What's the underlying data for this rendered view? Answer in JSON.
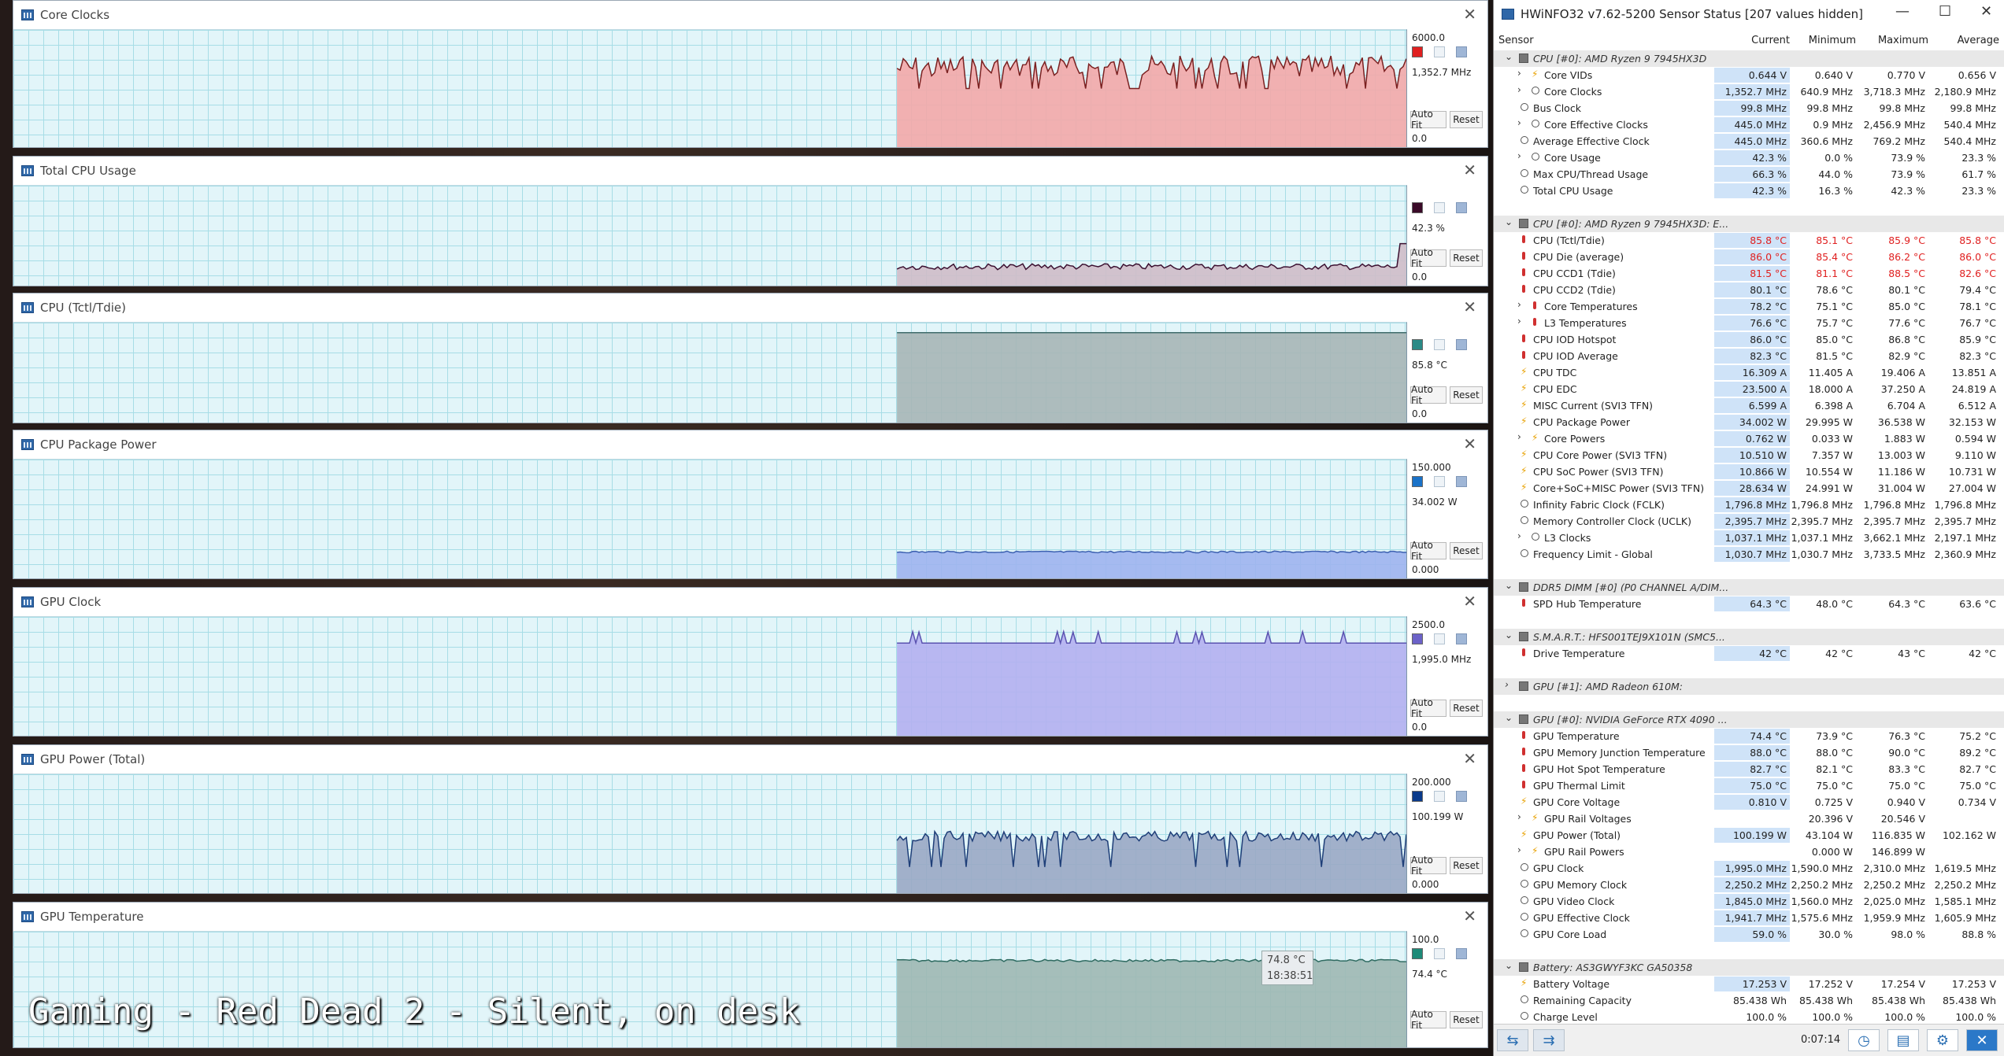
{
  "graphs": [
    {
      "title": "Core Clocks",
      "max": "6000.0",
      "current": "1,352.7 MHz",
      "min": "0.0",
      "color": "#e02020",
      "fill": "#f3a8a8",
      "stroke": "#7a2020",
      "profile": "clocks"
    },
    {
      "title": "Total CPU Usage",
      "max": "",
      "current": "42.3 %",
      "min": "0.0",
      "color": "#3a0a28",
      "fill": "#cfbcc8",
      "stroke": "#3a1030",
      "profile": "usage"
    },
    {
      "title": "CPU (Tctl/Tdie)",
      "max": "",
      "current": "85.8 °C",
      "min": "0.0",
      "color": "#2a8a86",
      "fill": "#a7b6b6",
      "stroke": "#3f6d6c",
      "profile": "flat_high"
    },
    {
      "title": "CPU Package Power",
      "max": "150.000",
      "current": "34.002 W",
      "min": "0.000",
      "color": "#1a72c8",
      "fill": "#9fb4ee",
      "stroke": "#3a5fb0",
      "profile": "flat_low"
    },
    {
      "title": "GPU Clock",
      "max": "2500.0",
      "current": "1,995.0 MHz",
      "min": "0.0",
      "color": "#6c62c8",
      "fill": "#b4b0f0",
      "stroke": "#5a52b0",
      "profile": "gpuclk"
    },
    {
      "title": "GPU Power (Total)",
      "max": "200.000",
      "current": "100.199 W",
      "min": "0.000",
      "color": "#0a3a8a",
      "fill": "#9aa8c4",
      "stroke": "#1e3e78",
      "profile": "gpupow"
    },
    {
      "title": "GPU Temperature",
      "max": "100.0",
      "current": "74.4 °C",
      "min": "",
      "color": "#1e8a78",
      "fill": "#9fb8b2",
      "stroke": "#2e6a60",
      "profile": "gputemp"
    }
  ],
  "labels": {
    "autofit": "Auto Fit",
    "reset": "Reset"
  },
  "tooltip": {
    "value": "74.8 °C",
    "time": "18:38:51"
  },
  "overlay_text": "Gaming - Red Dead 2 - Silent, on desk",
  "hwinfo": {
    "title": "HWiNFO32 v7.62-5200 Sensor Status [207 values hidden]",
    "columns": [
      "Sensor",
      "Current",
      "Minimum",
      "Maximum",
      "Average"
    ],
    "elapsed": "0:07:14",
    "rows": [
      {
        "t": "g",
        "name": "CPU [#0]: AMD Ryzen 9 7945HX3D"
      },
      {
        "t": "r",
        "ind": 2,
        "ex": true,
        "icon": "volt",
        "name": "Core VIDs",
        "v": [
          "0.644 V",
          "0.640 V",
          "0.770 V",
          "0.656 V"
        ],
        "hl": true
      },
      {
        "t": "r",
        "ind": 2,
        "ex": true,
        "icon": "clock",
        "name": "Core Clocks",
        "v": [
          "1,352.7 MHz",
          "640.9 MHz",
          "3,718.3 MHz",
          "2,180.9 MHz"
        ],
        "hl": true
      },
      {
        "t": "r",
        "ind": 1,
        "icon": "clock",
        "name": "Bus Clock",
        "v": [
          "99.8 MHz",
          "99.8 MHz",
          "99.8 MHz",
          "99.8 MHz"
        ],
        "hl": true
      },
      {
        "t": "r",
        "ind": 2,
        "ex": true,
        "icon": "clock",
        "name": "Core Effective Clocks",
        "v": [
          "445.0 MHz",
          "0.9 MHz",
          "2,456.9 MHz",
          "540.4 MHz"
        ],
        "hl": true
      },
      {
        "t": "r",
        "ind": 1,
        "icon": "clock",
        "name": "Average Effective Clock",
        "v": [
          "445.0 MHz",
          "360.6 MHz",
          "769.2 MHz",
          "540.4 MHz"
        ],
        "hl": true
      },
      {
        "t": "r",
        "ind": 2,
        "ex": true,
        "icon": "clock",
        "name": "Core Usage",
        "v": [
          "42.3 %",
          "0.0 %",
          "73.9 %",
          "23.3 %"
        ],
        "hl": true
      },
      {
        "t": "r",
        "ind": 1,
        "icon": "clock",
        "name": "Max CPU/Thread Usage",
        "v": [
          "66.3 %",
          "44.0 %",
          "73.9 %",
          "61.7 %"
        ],
        "hl": true
      },
      {
        "t": "r",
        "ind": 1,
        "icon": "clock",
        "name": "Total CPU Usage",
        "v": [
          "42.3 %",
          "16.3 %",
          "42.3 %",
          "23.3 %"
        ],
        "hl": true
      },
      {
        "t": "s"
      },
      {
        "t": "g",
        "name": "CPU [#0]: AMD Ryzen 9 7945HX3D: E..."
      },
      {
        "t": "r",
        "ind": 1,
        "icon": "therm",
        "name": "CPU (Tctl/Tdie)",
        "v": [
          "85.8 °C",
          "85.1 °C",
          "85.9 °C",
          "85.8 °C"
        ],
        "hl": true,
        "red": true
      },
      {
        "t": "r",
        "ind": 1,
        "icon": "therm",
        "name": "CPU Die (average)",
        "v": [
          "86.0 °C",
          "85.4 °C",
          "86.2 °C",
          "86.0 °C"
        ],
        "hl": true,
        "red": true
      },
      {
        "t": "r",
        "ind": 1,
        "icon": "therm",
        "name": "CPU CCD1 (Tdie)",
        "v": [
          "81.5 °C",
          "81.1 °C",
          "88.5 °C",
          "82.6 °C"
        ],
        "hl": true,
        "red": true
      },
      {
        "t": "r",
        "ind": 1,
        "icon": "therm",
        "name": "CPU CCD2 (Tdie)",
        "v": [
          "80.1 °C",
          "78.6 °C",
          "80.1 °C",
          "79.4 °C"
        ],
        "hl": true
      },
      {
        "t": "r",
        "ind": 2,
        "ex": true,
        "icon": "therm",
        "name": "Core Temperatures",
        "v": [
          "78.2 °C",
          "75.1 °C",
          "85.0 °C",
          "78.1 °C"
        ],
        "hl": true
      },
      {
        "t": "r",
        "ind": 2,
        "ex": true,
        "icon": "therm",
        "name": "L3 Temperatures",
        "v": [
          "76.6 °C",
          "75.7 °C",
          "77.6 °C",
          "76.7 °C"
        ],
        "hl": true
      },
      {
        "t": "r",
        "ind": 1,
        "icon": "therm",
        "name": "CPU IOD Hotspot",
        "v": [
          "86.0 °C",
          "85.0 °C",
          "86.8 °C",
          "85.9 °C"
        ],
        "hl": true
      },
      {
        "t": "r",
        "ind": 1,
        "icon": "therm",
        "name": "CPU IOD Average",
        "v": [
          "82.3 °C",
          "81.5 °C",
          "82.9 °C",
          "82.3 °C"
        ],
        "hl": true
      },
      {
        "t": "r",
        "ind": 1,
        "icon": "volt",
        "name": "CPU TDC",
        "v": [
          "16.309 A",
          "11.405 A",
          "19.406 A",
          "13.851 A"
        ],
        "hl": true
      },
      {
        "t": "r",
        "ind": 1,
        "icon": "volt",
        "name": "CPU EDC",
        "v": [
          "23.500 A",
          "18.000 A",
          "37.250 A",
          "24.819 A"
        ],
        "hl": true
      },
      {
        "t": "r",
        "ind": 1,
        "icon": "volt",
        "name": "MISC Current (SVI3 TFN)",
        "v": [
          "6.599 A",
          "6.398 A",
          "6.704 A",
          "6.512 A"
        ],
        "hl": true
      },
      {
        "t": "r",
        "ind": 1,
        "icon": "volt",
        "name": "CPU Package Power",
        "v": [
          "34.002 W",
          "29.995 W",
          "36.538 W",
          "32.153 W"
        ],
        "hl": true
      },
      {
        "t": "r",
        "ind": 2,
        "ex": true,
        "icon": "volt",
        "name": "Core Powers",
        "v": [
          "0.762 W",
          "0.033 W",
          "1.883 W",
          "0.594 W"
        ],
        "hl": true
      },
      {
        "t": "r",
        "ind": 1,
        "icon": "volt",
        "name": "CPU Core Power (SVI3 TFN)",
        "v": [
          "10.510 W",
          "7.357 W",
          "13.003 W",
          "9.110 W"
        ],
        "hl": true
      },
      {
        "t": "r",
        "ind": 1,
        "icon": "volt",
        "name": "CPU SoC Power (SVI3 TFN)",
        "v": [
          "10.866 W",
          "10.554 W",
          "11.186 W",
          "10.731 W"
        ],
        "hl": true
      },
      {
        "t": "r",
        "ind": 1,
        "icon": "volt",
        "name": "Core+SoC+MISC Power (SVI3 TFN)",
        "v": [
          "28.634 W",
          "24.991 W",
          "31.004 W",
          "27.004 W"
        ],
        "hl": true
      },
      {
        "t": "r",
        "ind": 1,
        "icon": "clock",
        "name": "Infinity Fabric Clock (FCLK)",
        "v": [
          "1,796.8 MHz",
          "1,796.8 MHz",
          "1,796.8 MHz",
          "1,796.8 MHz"
        ],
        "hl": true
      },
      {
        "t": "r",
        "ind": 1,
        "icon": "clock",
        "name": "Memory Controller Clock (UCLK)",
        "v": [
          "2,395.7 MHz",
          "2,395.7 MHz",
          "2,395.7 MHz",
          "2,395.7 MHz"
        ],
        "hl": true
      },
      {
        "t": "r",
        "ind": 2,
        "ex": true,
        "icon": "clock",
        "name": "L3 Clocks",
        "v": [
          "1,037.1 MHz",
          "1,037.1 MHz",
          "3,662.1 MHz",
          "2,197.1 MHz"
        ],
        "hl": true
      },
      {
        "t": "r",
        "ind": 1,
        "icon": "clock",
        "name": "Frequency Limit - Global",
        "v": [
          "1,030.7 MHz",
          "1,030.7 MHz",
          "3,733.5 MHz",
          "2,360.9 MHz"
        ],
        "hl": true
      },
      {
        "t": "s"
      },
      {
        "t": "g",
        "name": "DDR5 DIMM [#0] (P0 CHANNEL A/DIM..."
      },
      {
        "t": "r",
        "ind": 1,
        "icon": "therm",
        "name": "SPD Hub Temperature",
        "v": [
          "64.3 °C",
          "48.0 °C",
          "64.3 °C",
          "63.6 °C"
        ],
        "hl": true
      },
      {
        "t": "s"
      },
      {
        "t": "g",
        "name": "S.M.A.R.T.: HFS001TEJ9X101N (SMC5..."
      },
      {
        "t": "r",
        "ind": 1,
        "icon": "therm",
        "name": "Drive Temperature",
        "v": [
          "42 °C",
          "42 °C",
          "43 °C",
          "42 °C"
        ],
        "hl": true
      },
      {
        "t": "s"
      },
      {
        "t": "g",
        "name": "GPU [#1]: AMD Radeon 610M:",
        "collapsed": true
      },
      {
        "t": "s"
      },
      {
        "t": "g",
        "name": "GPU [#0]: NVIDIA GeForce RTX 4090 ..."
      },
      {
        "t": "r",
        "ind": 1,
        "icon": "therm",
        "name": "GPU Temperature",
        "v": [
          "74.4 °C",
          "73.9 °C",
          "76.3 °C",
          "75.2 °C"
        ],
        "hl": true
      },
      {
        "t": "r",
        "ind": 1,
        "icon": "therm",
        "name": "GPU Memory Junction Temperature",
        "v": [
          "88.0 °C",
          "88.0 °C",
          "90.0 °C",
          "89.2 °C"
        ],
        "hl": true
      },
      {
        "t": "r",
        "ind": 1,
        "icon": "therm",
        "name": "GPU Hot Spot Temperature",
        "v": [
          "82.7 °C",
          "82.1 °C",
          "83.3 °C",
          "82.7 °C"
        ],
        "hl": true
      },
      {
        "t": "r",
        "ind": 1,
        "icon": "therm",
        "name": "GPU Thermal Limit",
        "v": [
          "75.0 °C",
          "75.0 °C",
          "75.0 °C",
          "75.0 °C"
        ],
        "hl": true
      },
      {
        "t": "r",
        "ind": 1,
        "icon": "volt",
        "name": "GPU Core Voltage",
        "v": [
          "0.810 V",
          "0.725 V",
          "0.940 V",
          "0.734 V"
        ],
        "hl": true
      },
      {
        "t": "r",
        "ind": 2,
        "ex": true,
        "icon": "volt",
        "name": "GPU Rail Voltages",
        "v": [
          "",
          "20.396 V",
          "20.546 V",
          ""
        ],
        "hl": false
      },
      {
        "t": "r",
        "ind": 1,
        "icon": "volt",
        "name": "GPU Power (Total)",
        "v": [
          "100.199 W",
          "43.104 W",
          "116.835 W",
          "102.162 W"
        ],
        "hl": true
      },
      {
        "t": "r",
        "ind": 2,
        "ex": true,
        "icon": "volt",
        "name": "GPU Rail Powers",
        "v": [
          "",
          "0.000 W",
          "146.899 W",
          ""
        ],
        "hl": false
      },
      {
        "t": "r",
        "ind": 1,
        "icon": "clock",
        "name": "GPU Clock",
        "v": [
          "1,995.0 MHz",
          "1,590.0 MHz",
          "2,310.0 MHz",
          "1,619.5 MHz"
        ],
        "hl": true
      },
      {
        "t": "r",
        "ind": 1,
        "icon": "clock",
        "name": "GPU Memory Clock",
        "v": [
          "2,250.2 MHz",
          "2,250.2 MHz",
          "2,250.2 MHz",
          "2,250.2 MHz"
        ],
        "hl": true
      },
      {
        "t": "r",
        "ind": 1,
        "icon": "clock",
        "name": "GPU Video Clock",
        "v": [
          "1,845.0 MHz",
          "1,560.0 MHz",
          "2,025.0 MHz",
          "1,585.1 MHz"
        ],
        "hl": true
      },
      {
        "t": "r",
        "ind": 1,
        "icon": "clock",
        "name": "GPU Effective Clock",
        "v": [
          "1,941.7 MHz",
          "1,575.6 MHz",
          "1,959.9 MHz",
          "1,605.9 MHz"
        ],
        "hl": true
      },
      {
        "t": "r",
        "ind": 1,
        "icon": "clock",
        "name": "GPU Core Load",
        "v": [
          "59.0 %",
          "30.0 %",
          "98.0 %",
          "88.8 %"
        ],
        "hl": true
      },
      {
        "t": "s"
      },
      {
        "t": "g",
        "name": "Battery: AS3GWYF3KC GA50358"
      },
      {
        "t": "r",
        "ind": 1,
        "icon": "volt",
        "name": "Battery Voltage",
        "v": [
          "17.253 V",
          "17.252 V",
          "17.254 V",
          "17.253 V"
        ],
        "hl": true
      },
      {
        "t": "r",
        "ind": 1,
        "icon": "clock",
        "name": "Remaining Capacity",
        "v": [
          "85.438 Wh",
          "85.438 Wh",
          "85.438 Wh",
          "85.438 Wh"
        ],
        "hl": false
      },
      {
        "t": "r",
        "ind": 1,
        "icon": "clock",
        "name": "Charge Level",
        "v": [
          "100.0 %",
          "100.0 %",
          "100.0 %",
          "100.0 %"
        ],
        "hl": false
      }
    ]
  }
}
